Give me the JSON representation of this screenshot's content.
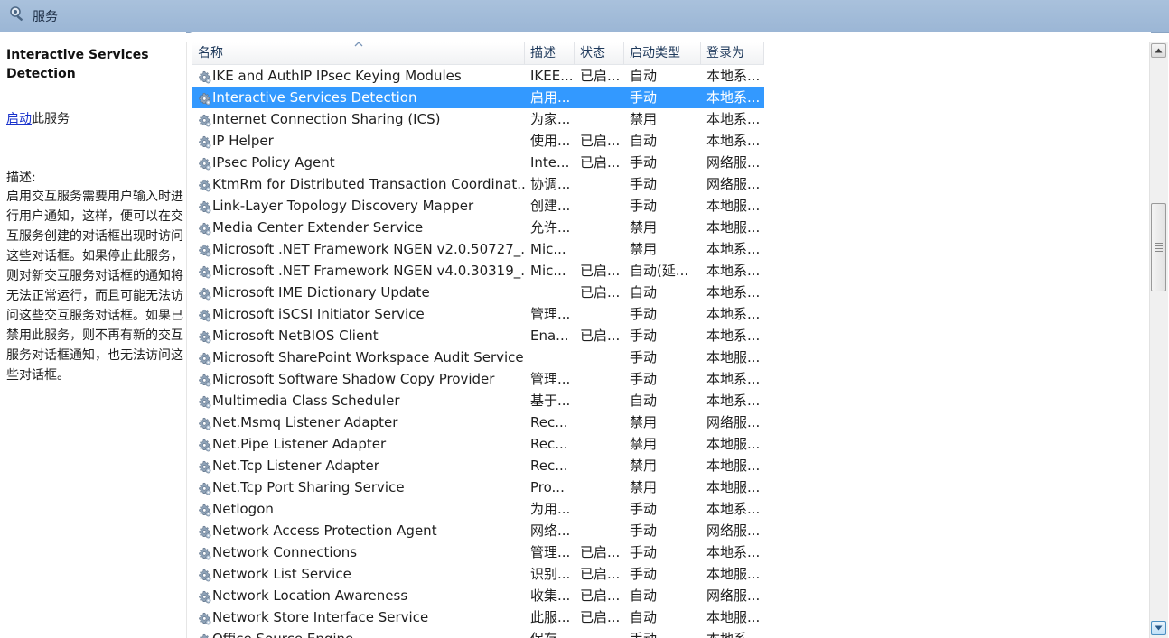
{
  "window": {
    "title": "服务"
  },
  "detail": {
    "service_name": "Interactive Services Detection",
    "start_link": "启动",
    "start_suffix": "此服务",
    "desc_label": "描述:",
    "desc_text": "启用交互服务需要用户输入时进行用户通知，这样，便可以在交互服务创建的对话框出现时访问这些对话框。如果停止此服务，则对新交互服务对话框的通知将无法正常运行，而且可能无法访问这些交互服务对话框。如果已禁用此服务，则不再有新的交互服务对话框通知，也无法访问这些对话框。"
  },
  "columns": [
    "名称",
    "描述",
    "状态",
    "启动类型",
    "登录为"
  ],
  "services": [
    {
      "name": "IKE and AuthIP IPsec Keying Modules",
      "desc": "IKEE...",
      "status": "已启...",
      "type": "自动",
      "logon": "本地系..."
    },
    {
      "name": "Interactive Services Detection",
      "desc": "启用...",
      "status": "",
      "type": "手动",
      "logon": "本地系...",
      "selected": true
    },
    {
      "name": "Internet Connection Sharing (ICS)",
      "desc": "为家...",
      "status": "",
      "type": "禁用",
      "logon": "本地系..."
    },
    {
      "name": "IP Helper",
      "desc": "使用...",
      "status": "已启...",
      "type": "自动",
      "logon": "本地系..."
    },
    {
      "name": "IPsec Policy Agent",
      "desc": "Inte...",
      "status": "已启...",
      "type": "手动",
      "logon": "网络服..."
    },
    {
      "name": "KtmRm for Distributed Transaction Coordinat...",
      "desc": "协调...",
      "status": "",
      "type": "手动",
      "logon": "网络服..."
    },
    {
      "name": "Link-Layer Topology Discovery Mapper",
      "desc": "创建...",
      "status": "",
      "type": "手动",
      "logon": "本地服..."
    },
    {
      "name": "Media Center Extender Service",
      "desc": "允许...",
      "status": "",
      "type": "禁用",
      "logon": "本地服..."
    },
    {
      "name": "Microsoft .NET Framework NGEN v2.0.50727_...",
      "desc": "Mic...",
      "status": "",
      "type": "禁用",
      "logon": "本地系..."
    },
    {
      "name": "Microsoft .NET Framework NGEN v4.0.30319_...",
      "desc": "Mic...",
      "status": "已启...",
      "type": "自动(延...",
      "logon": "本地系..."
    },
    {
      "name": "Microsoft IME Dictionary Update",
      "desc": "",
      "status": "已启...",
      "type": "自动",
      "logon": "本地系..."
    },
    {
      "name": "Microsoft iSCSI Initiator Service",
      "desc": "管理...",
      "status": "",
      "type": "手动",
      "logon": "本地系..."
    },
    {
      "name": "Microsoft NetBIOS Client",
      "desc": "Ena...",
      "status": "已启...",
      "type": "手动",
      "logon": "本地系..."
    },
    {
      "name": "Microsoft SharePoint Workspace Audit Service",
      "desc": "",
      "status": "",
      "type": "手动",
      "logon": "本地服..."
    },
    {
      "name": "Microsoft Software Shadow Copy Provider",
      "desc": "管理...",
      "status": "",
      "type": "手动",
      "logon": "本地系..."
    },
    {
      "name": "Multimedia Class Scheduler",
      "desc": "基于...",
      "status": "",
      "type": "自动",
      "logon": "本地系..."
    },
    {
      "name": "Net.Msmq Listener Adapter",
      "desc": "Rec...",
      "status": "",
      "type": "禁用",
      "logon": "网络服..."
    },
    {
      "name": "Net.Pipe Listener Adapter",
      "desc": "Rec...",
      "status": "",
      "type": "禁用",
      "logon": "本地服..."
    },
    {
      "name": "Net.Tcp Listener Adapter",
      "desc": "Rec...",
      "status": "",
      "type": "禁用",
      "logon": "本地服..."
    },
    {
      "name": "Net.Tcp Port Sharing Service",
      "desc": "Pro...",
      "status": "",
      "type": "禁用",
      "logon": "本地服..."
    },
    {
      "name": "Netlogon",
      "desc": "为用...",
      "status": "",
      "type": "手动",
      "logon": "本地系..."
    },
    {
      "name": "Network Access Protection Agent",
      "desc": "网络...",
      "status": "",
      "type": "手动",
      "logon": "网络服..."
    },
    {
      "name": "Network Connections",
      "desc": "管理...",
      "status": "已启...",
      "type": "手动",
      "logon": "本地系..."
    },
    {
      "name": "Network List Service",
      "desc": "识别...",
      "status": "已启...",
      "type": "手动",
      "logon": "本地服..."
    },
    {
      "name": "Network Location Awareness",
      "desc": "收集...",
      "status": "已启...",
      "type": "自动",
      "logon": "网络服..."
    },
    {
      "name": "Network Store Interface Service",
      "desc": "此服...",
      "status": "已启...",
      "type": "自动",
      "logon": "本地服..."
    },
    {
      "name": "Office Source Engine",
      "desc": "保存...",
      "status": "",
      "type": "手动",
      "logon": "本地系..."
    }
  ],
  "icons": {
    "header": "services-gear-magnifier-icon",
    "row": "gear-icon",
    "sort": "sort-ascending-icon",
    "scroll_up": "scroll-up-arrow-icon",
    "scroll_down": "scroll-down-arrow-icon"
  },
  "colors": {
    "header_bg": "#9bb6d5",
    "selection": "#3399ff",
    "link": "#1a33cc"
  }
}
